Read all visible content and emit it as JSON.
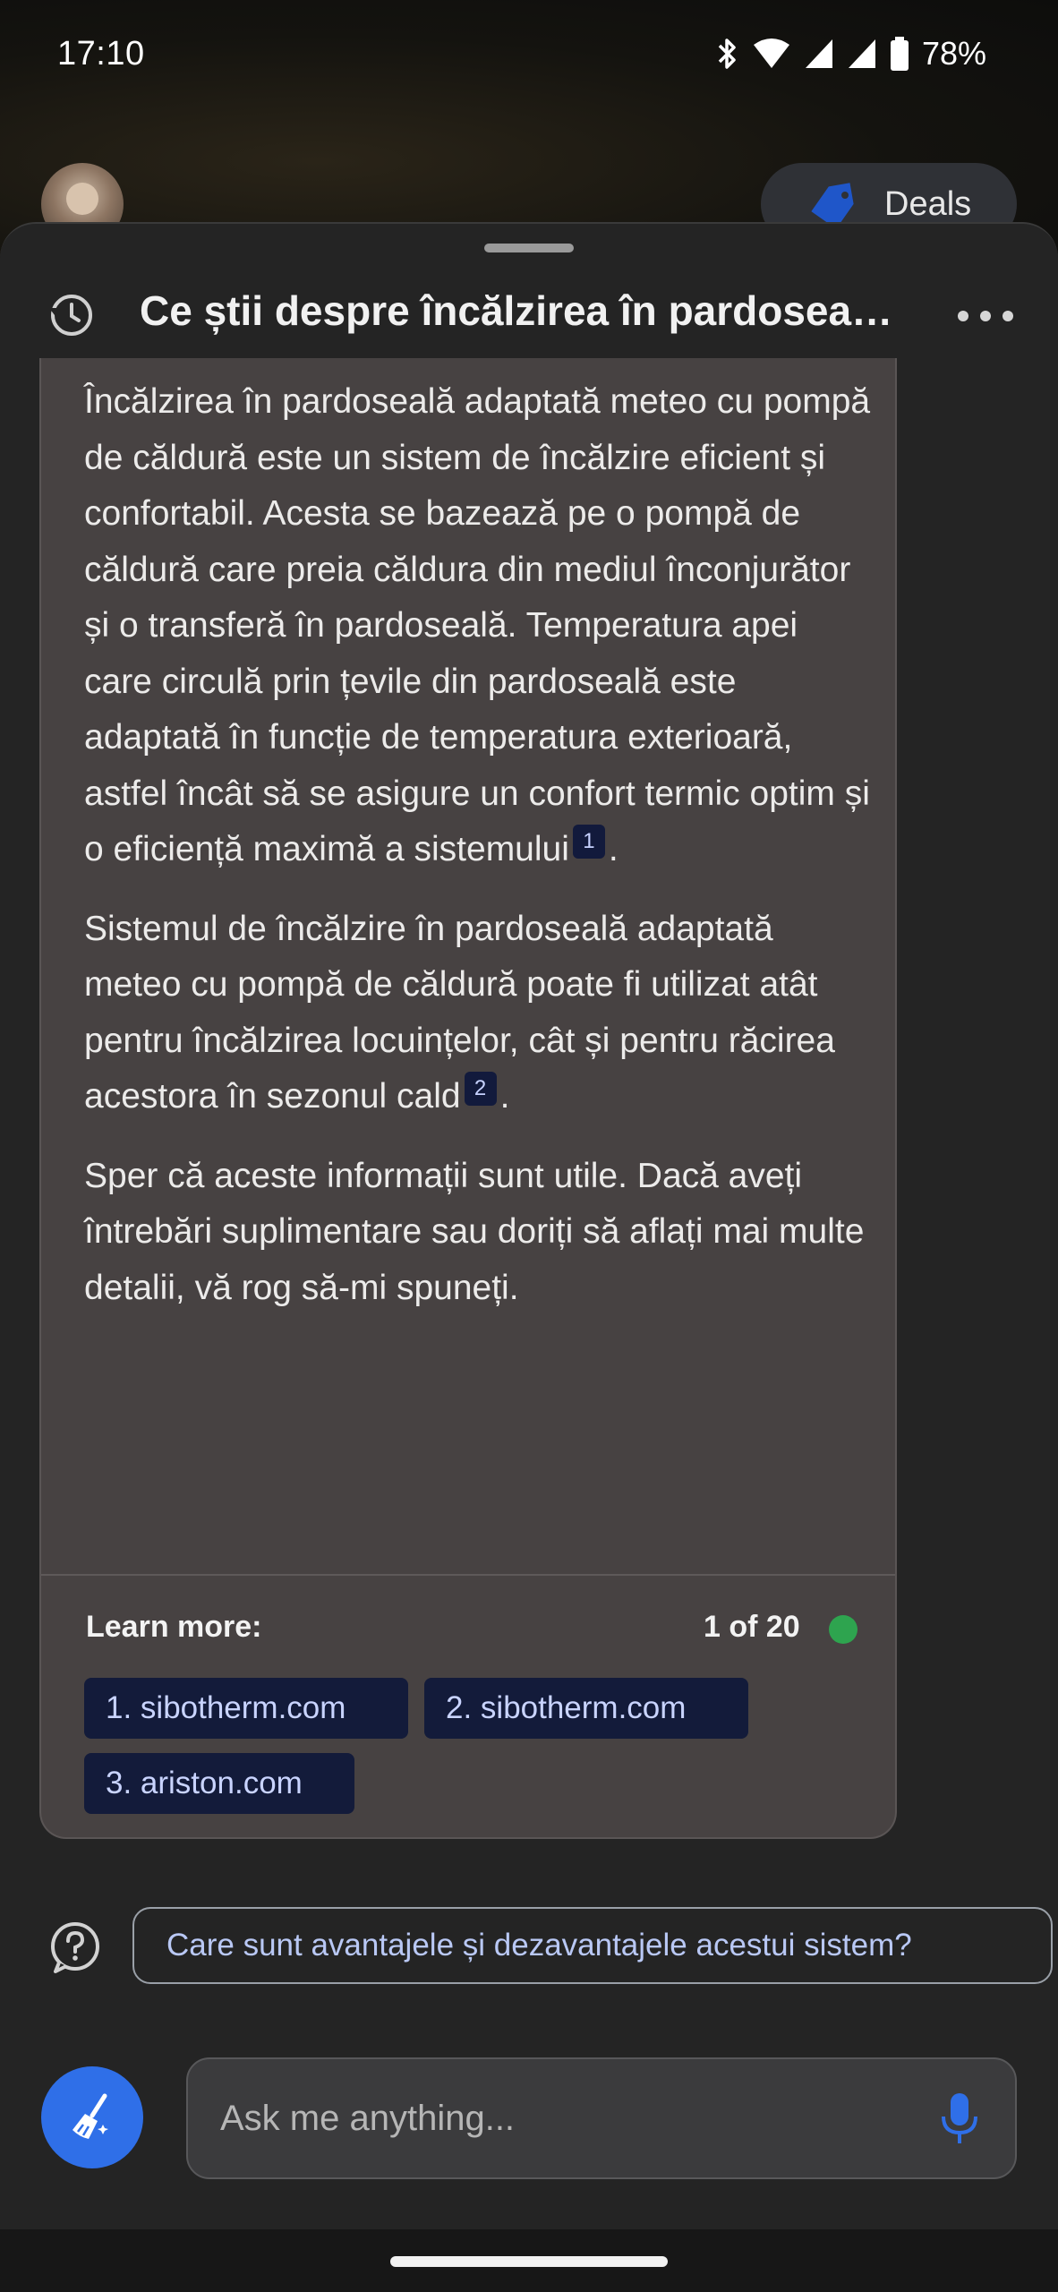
{
  "status_bar": {
    "time": "17:10",
    "battery": "78%",
    "icons": [
      "bluetooth-icon",
      "wifi-icon",
      "signal-icon",
      "signal-icon",
      "battery-icon"
    ]
  },
  "top": {
    "deals_label": "Deals"
  },
  "header": {
    "title": "Ce știi despre încălzirea în pardosea…",
    "history_icon": "history-icon",
    "more_icon": "more-options-icon"
  },
  "message": {
    "paragraph1": "Încălzirea în pardoseală adaptată meteo cu pompă de căldură este un sistem de încălzire eficient și confortabil. Acesta se bazează pe o pompă de căldură care preia căldura din mediul înconjurător și o transferă în pardoseală. Temperatura apei care circulă prin țevile din pardoseală este adaptată în funcție de temperatura exterioară, astfel încât să se asigure un confort termic optim și o eficiență maximă a sistemului",
    "cite1": "1",
    "paragraph1_end": ".",
    "paragraph2": "Sistemul de încălzire în pardoseală adaptată meteo cu pompă de căldură poate fi utilizat atât pentru încălzirea locuințelor, cât și pentru răcirea acestora în sezonul cald",
    "cite2": "2",
    "paragraph2_end": ".",
    "paragraph3": "Sper că aceste informații sunt utile. Dacă aveți întrebări suplimentare sau doriți să aflați mai multe detalii, vă rog să-mi spuneți."
  },
  "learn_more": {
    "label": "Learn more:",
    "page_count": "1 of 20",
    "sources": [
      "1. sibotherm.com",
      "2. sibotherm.com",
      "3. ariston.com"
    ],
    "status_color": "#2ea44f"
  },
  "suggestion": {
    "text": "Care sunt avantajele și dezavantajele acestui sistem?",
    "icon": "help-icon"
  },
  "composer": {
    "placeholder": "Ask me anything...",
    "new_topic_icon": "broom-icon",
    "mic_icon": "microphone-icon",
    "accent_color": "#2f6fe8"
  }
}
